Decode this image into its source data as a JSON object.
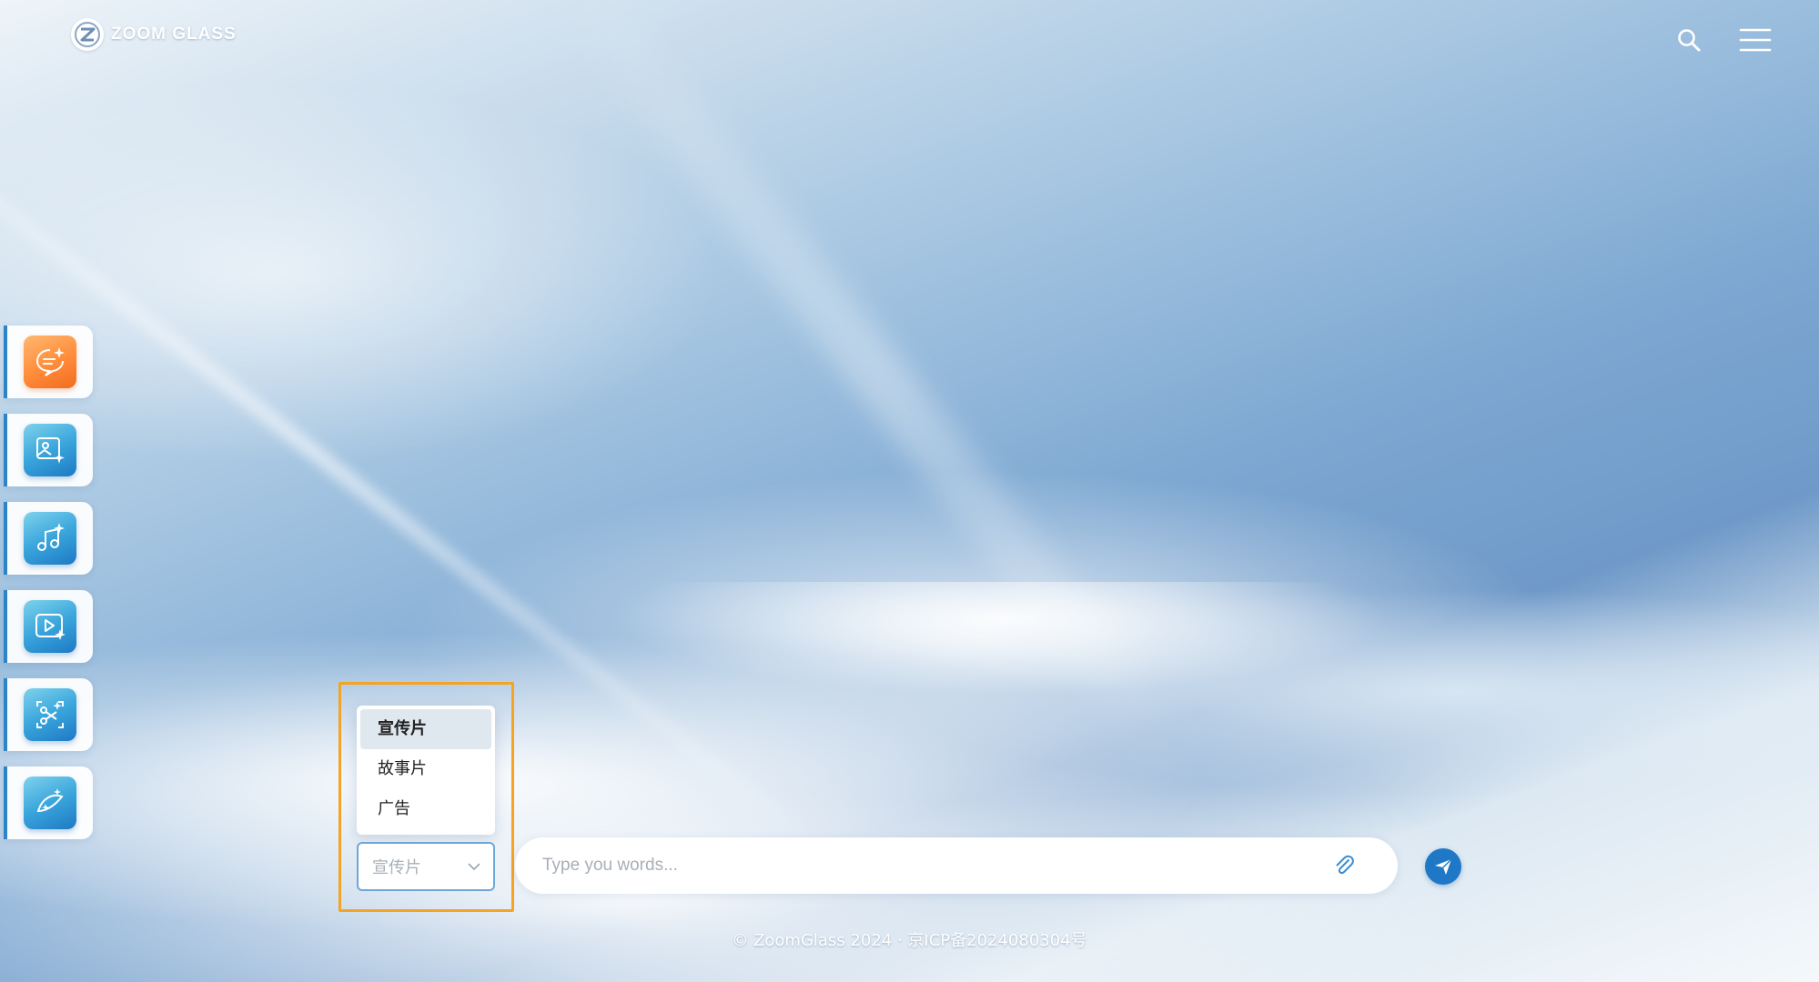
{
  "header": {
    "logo_text": "ZOOM GLASS",
    "logo_icon": "z-globe-logo-icon",
    "search_icon": "search-icon",
    "menu_icon": "hamburger-menu-icon"
  },
  "sidebar": {
    "items": [
      {
        "icon": "chat-sparkle-icon",
        "accent": "#ff8c3a",
        "active": true
      },
      {
        "icon": "image-sparkle-icon",
        "accent": "#2b9ad6"
      },
      {
        "icon": "music-sparkle-icon",
        "accent": "#2b9ad6"
      },
      {
        "icon": "video-sparkle-icon",
        "accent": "#2b9ad6"
      },
      {
        "icon": "scissors-sparkle-icon",
        "accent": "#2b9ad6"
      },
      {
        "icon": "magic-wand-sparkle-icon",
        "accent": "#2b9ad6"
      }
    ]
  },
  "category_select": {
    "value": "宣传片",
    "options": [
      "宣传片",
      "故事片",
      "广告"
    ],
    "selected_index": 0
  },
  "composer": {
    "placeholder": "Type you words...",
    "attach_icon": "paperclip-icon",
    "send_icon": "paper-plane-send-icon"
  },
  "footer": {
    "text": "© ZoomGlass 2024 · 京ICP备2024080304号"
  },
  "colors": {
    "highlight_border": "#f5a323",
    "send_button": "#1f78c6",
    "sidebar_accent": "#2b83c8"
  }
}
